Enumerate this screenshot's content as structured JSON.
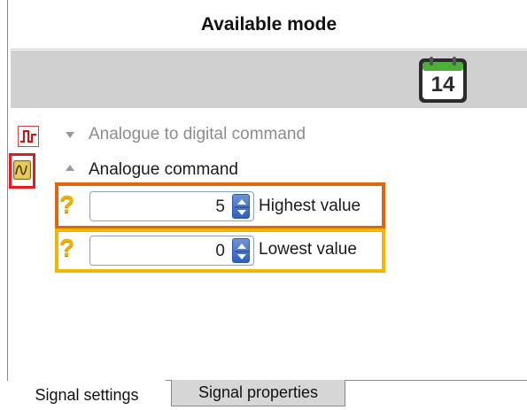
{
  "header": {
    "title": "Available mode"
  },
  "toolbar": {
    "calendar_day": "14"
  },
  "modes": [
    {
      "label": "Analogue to digital command",
      "state": "collapsed"
    },
    {
      "label": "Analogue command",
      "state": "expanded"
    }
  ],
  "fields": {
    "highest": {
      "value": "5",
      "label": "Highest value"
    },
    "lowest": {
      "value": "0",
      "label": "Lowest value"
    }
  },
  "help_symbol": "?",
  "tabs": [
    {
      "label": "Signal settings",
      "active": true
    },
    {
      "label": "Signal properties",
      "active": false
    }
  ],
  "colors": {
    "highlight_red": "#e31b1b",
    "highlight_orange": "#e0650c",
    "highlight_yellow": "#f2b600",
    "toolbar_bg": "#d0d0d0",
    "disabled_text": "#8c8c8c"
  }
}
